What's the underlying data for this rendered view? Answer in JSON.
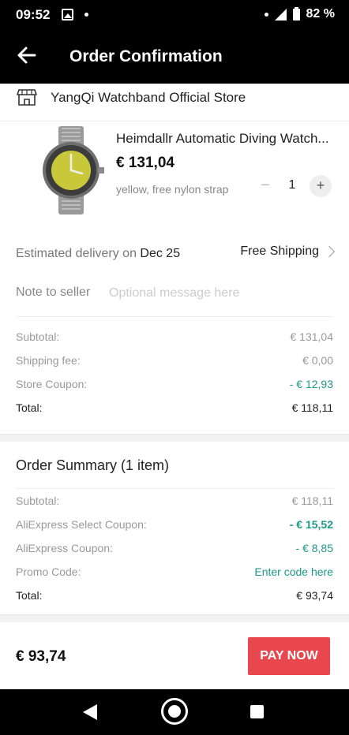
{
  "status_bar": {
    "time": "09:52",
    "battery": "82 %"
  },
  "app_bar": {
    "title": "Order Confirmation"
  },
  "store": {
    "name": "YangQi Watchband Official Store"
  },
  "product": {
    "title": "Heimdallr Automatic Diving Watch...",
    "price": "€ 131,04",
    "variant": "yellow, free nylon strap",
    "quantity": "1",
    "minus_label": "−",
    "plus_label": "+"
  },
  "delivery": {
    "label": "Estimated delivery on ",
    "date": "Dec 25",
    "shipping": "Free Shipping"
  },
  "note": {
    "label": "Note to seller",
    "placeholder": "Optional message here"
  },
  "store_totals": [
    {
      "label": "Subtotal:",
      "value": "€ 131,04"
    },
    {
      "label": "Shipping fee:",
      "value": "€ 0,00"
    },
    {
      "label": "Store Coupon:",
      "value": "- € 12,93"
    },
    {
      "label": "Total:",
      "value": "€ 118,11"
    }
  ],
  "order_summary": {
    "title": "Order Summary (1 item)",
    "lines": [
      {
        "label": "Subtotal:",
        "value": "€ 118,11"
      },
      {
        "label": "AliExpress Select Coupon:",
        "value": "- € 15,52"
      },
      {
        "label": "AliExpress Coupon:",
        "value": "- € 8,85"
      },
      {
        "label": "Promo Code:",
        "value": "Enter code here"
      },
      {
        "label": "Total:",
        "value": "€ 93,74"
      }
    ]
  },
  "bottom": {
    "total": "€ 93,74",
    "pay_label": "PAY NOW"
  },
  "colors": {
    "accent": "#e8484d",
    "discount": "#1b9a86",
    "bar": "#000000"
  }
}
